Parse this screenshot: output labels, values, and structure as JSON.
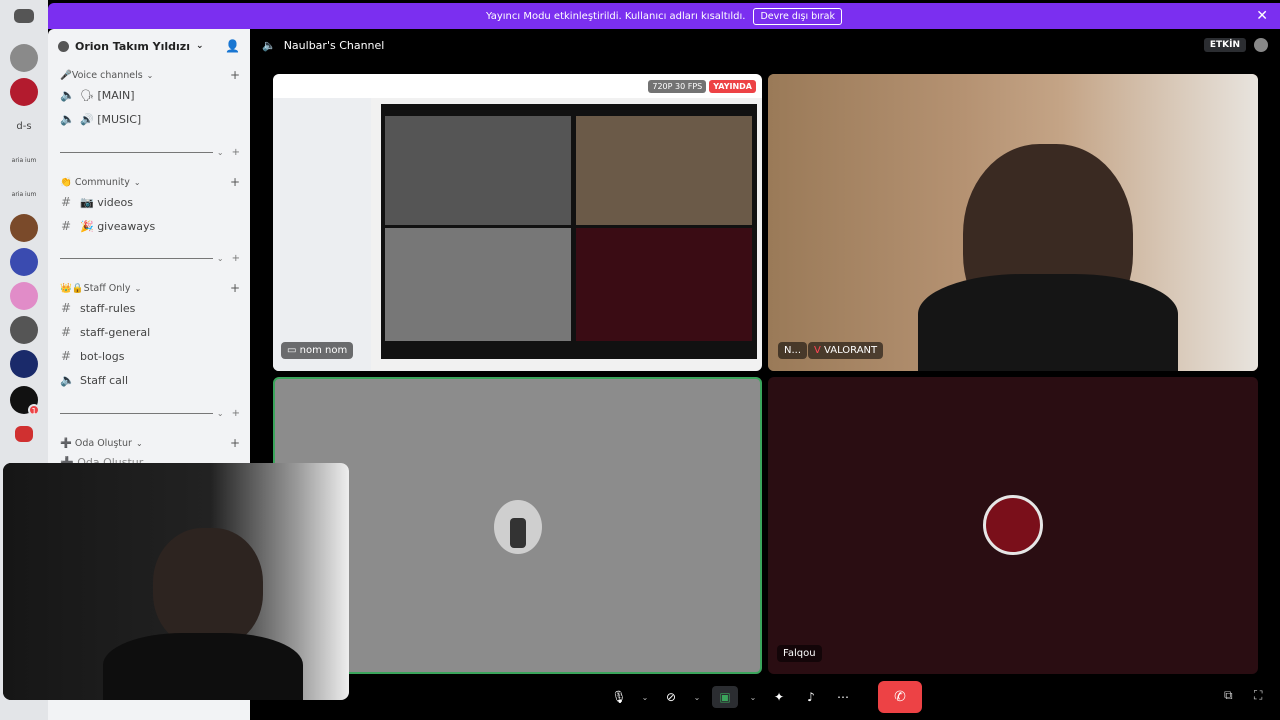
{
  "banner": {
    "message": "Yayıncı Modu etkinleştirildi. Kullanıcı adları kısaltıldı.",
    "button_label": "Devre dışı bırak",
    "close_icon": "close-icon",
    "color": "#7b2ff0"
  },
  "rail": {
    "servers": [
      {
        "label": "",
        "color": "#5865f2"
      },
      {
        "label": "",
        "color": "#8a8a8a"
      },
      {
        "label": "",
        "color": "#b31b2e"
      },
      {
        "label": "d-s",
        "color": "transparent"
      },
      {
        "label": "aria ium",
        "color": "transparent"
      },
      {
        "label": "aria ium",
        "color": "transparent"
      },
      {
        "label": "",
        "color": "#7a4a2a"
      },
      {
        "label": "",
        "color": "#3a4bb0"
      },
      {
        "label": "",
        "color": "#e18cc8"
      },
      {
        "label": "",
        "color": "#555"
      },
      {
        "label": "",
        "color": "#1a2a6a"
      },
      {
        "label": "",
        "color": "#111"
      },
      {
        "label": "",
        "color": "#d03030"
      }
    ],
    "badge_count": "1"
  },
  "sidebar": {
    "server_name": "Orion Takım Yıldızı",
    "categories": {
      "voice": "🎤Voice channels",
      "community": "👏 Community",
      "staff": "👑🔒Staff Only",
      "create": "➕ Oda Oluştur"
    },
    "channels": {
      "main": "🗣 [MAIN]",
      "music": "🔊 [MUSIC]",
      "videos": "📷 videos",
      "giveaways": "🎉 giveaways",
      "staff_rules": "staff-rules",
      "staff_general": "staff-general",
      "bot_logs": "bot-logs",
      "staff_call": "Staff call",
      "create_partial": "➕ Oda Oluştur"
    }
  },
  "main": {
    "channel_title": "Naulbar's Channel",
    "activity_label": "ETKİN",
    "tiles": {
      "stream_user_label": "nom nom",
      "stream_quality": "720P 30 FPS",
      "live_label": "YAYINDA",
      "cam_user_short": "N...",
      "cam_activity": "VALORANT",
      "falqou_label": "Falqou"
    }
  }
}
